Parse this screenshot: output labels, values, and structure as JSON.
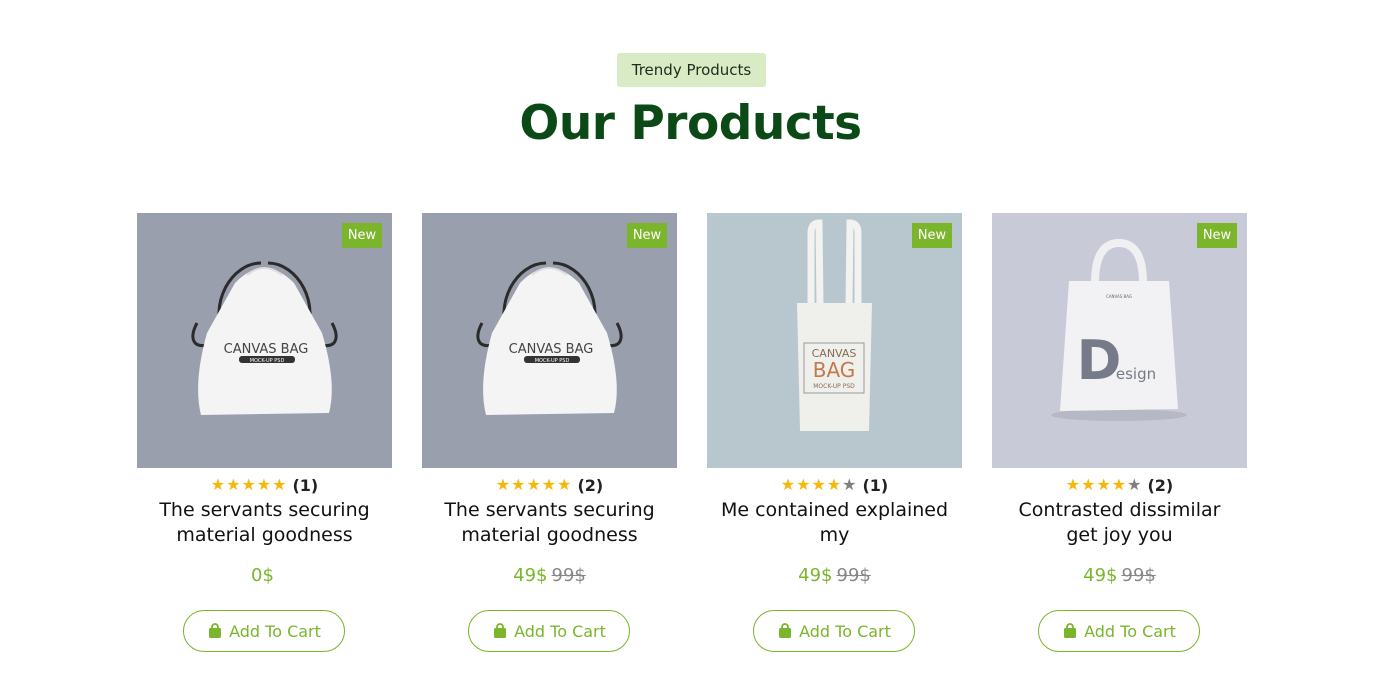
{
  "section": {
    "badge": "Trendy Products",
    "title": "Our Products"
  },
  "colors": {
    "accent": "#7bb52c",
    "title": "#0b4a17",
    "badge_bg": "#d9ebc4",
    "star": "#f5b70a"
  },
  "products": [
    {
      "tag": "New",
      "image": "canvas-drawstring-bag",
      "rating": 5,
      "reviews": "(1)",
      "name": "The servants securing material goodness",
      "price": "0$",
      "old_price": "",
      "cart_label": "Add To Cart"
    },
    {
      "tag": "New",
      "image": "canvas-drawstring-bag",
      "rating": 5,
      "reviews": "(2)",
      "name": "The servants securing material goodness",
      "price": "49$",
      "old_price": "99$",
      "cart_label": "Add To Cart"
    },
    {
      "tag": "New",
      "image": "canvas-tote-bag",
      "rating": 4,
      "reviews": "(1)",
      "name": "Me contained explained my",
      "price": "49$",
      "old_price": "99$",
      "cart_label": "Add To Cart"
    },
    {
      "tag": "New",
      "image": "design-tote-bag",
      "rating": 4,
      "reviews": "(2)",
      "name": "Contrasted dissimilar get joy you",
      "price": "49$",
      "old_price": "99$",
      "cart_label": "Add To Cart"
    }
  ],
  "image_text": {
    "canvas_bag": "CANVAS BAG",
    "mockup": "MOCK-UP PSD",
    "canvas": "CANVAS",
    "bag": "BAG",
    "design_d": "D",
    "design_rest": "esign"
  }
}
